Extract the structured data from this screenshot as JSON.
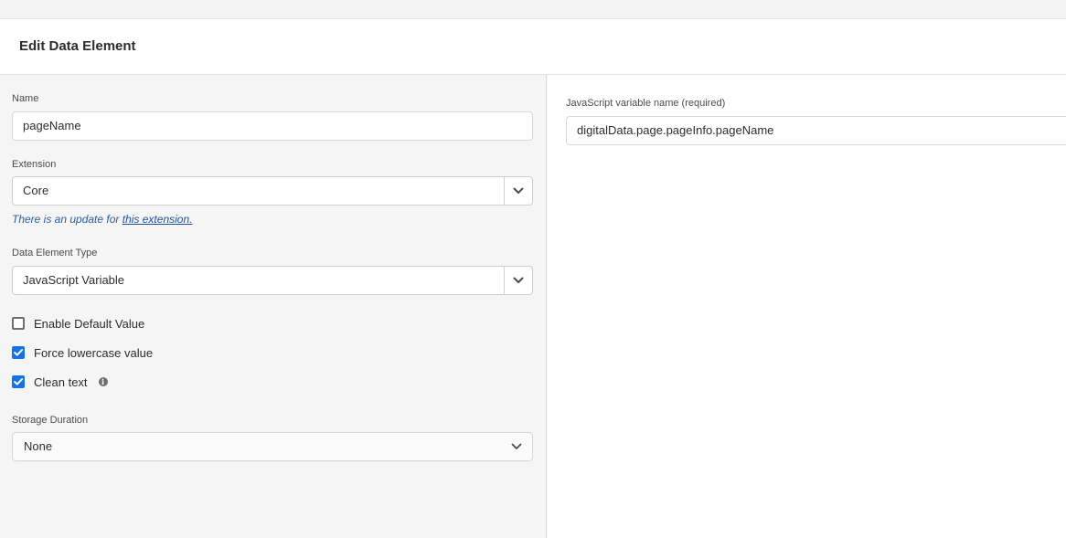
{
  "header": {
    "title": "Edit Data Element"
  },
  "form": {
    "name": {
      "label": "Name",
      "value": "pageName"
    },
    "extension": {
      "label": "Extension",
      "value": "Core",
      "notice_text": "There is an update for ",
      "notice_link": "this extension."
    },
    "data_element_type": {
      "label": "Data Element Type",
      "value": "JavaScript Variable"
    },
    "checkboxes": [
      {
        "label": "Enable Default Value",
        "checked": false
      },
      {
        "label": "Force lowercase value",
        "checked": true
      },
      {
        "label": "Clean text",
        "checked": true
      }
    ],
    "storage_duration": {
      "label": "Storage Duration",
      "value": "None"
    }
  },
  "settings": {
    "js_variable": {
      "label": "JavaScript variable name (required)",
      "value": "digitalData.page.pageInfo.pageName"
    }
  },
  "colors": {
    "accent": "#1473e6",
    "link": "#1d4f9c"
  }
}
